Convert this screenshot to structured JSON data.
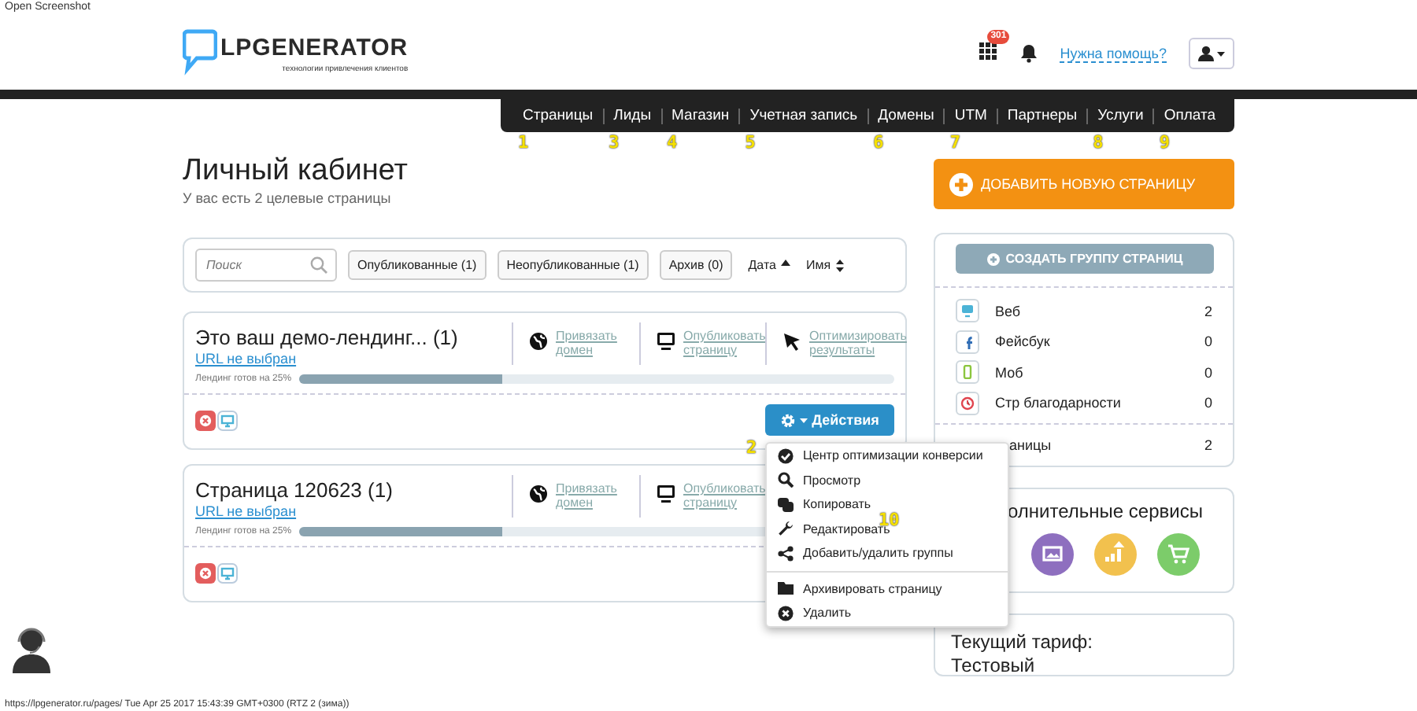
{
  "caption": "Open Screenshot",
  "header": {
    "logo_name": "LPGENERATOR",
    "logo_tagline": "технологии привлечения клиентов",
    "apps_badge": "301",
    "help_link": "Нужна помощь?"
  },
  "nav": [
    {
      "label": "Страницы",
      "annotation": "1"
    },
    {
      "label": "Лиды",
      "annotation": "3"
    },
    {
      "label": "Магазин",
      "annotation": "4"
    },
    {
      "label": "Учетная запись",
      "annotation": "5"
    },
    {
      "label": "Домены",
      "annotation": "6"
    },
    {
      "label": "UTM",
      "annotation": "7"
    },
    {
      "label": "Партнеры"
    },
    {
      "label": "Услуги",
      "annotation": "8"
    },
    {
      "label": "Оплата",
      "annotation": "9"
    }
  ],
  "page": {
    "title": "Личный кабинет",
    "subtitle": "У вас есть 2 целевые страницы"
  },
  "filters": {
    "search_placeholder": "Поиск",
    "buttons": [
      "Опубликованные (1)",
      "Неопубликованные (1)",
      "Архив (0)"
    ],
    "sorts": [
      {
        "label": "Дата",
        "kind": "asc"
      },
      {
        "label": "Имя",
        "kind": "both"
      }
    ]
  },
  "pages": [
    {
      "title": "Это ваш демо-лендинг... (1)",
      "url": "URL не выбран",
      "links": [
        {
          "kind": "globe",
          "text": "Привязать домен"
        },
        {
          "kind": "monitor",
          "text": "Опубликовать страницу"
        },
        {
          "kind": "cursor",
          "text": "Оптимизировать результаты"
        }
      ],
      "progress_label": "Лендинг готов на 25%",
      "level": 0.34,
      "actions": {
        "label": "Действия",
        "annotation": "2"
      }
    },
    {
      "title": "Страница 120623 (1)",
      "url": "URL не выбран",
      "links": [
        {
          "kind": "globe",
          "text": "Привязать домен"
        },
        {
          "kind": "monitor",
          "text": "Опубликовать страницу"
        }
      ],
      "progress_label": "Лендинг готов на 25%",
      "level": 0.34
    }
  ],
  "menu": [
    {
      "kind": "check",
      "label": "Центр оптимизации конверсии",
      "divider_before": false
    },
    {
      "kind": "search",
      "label": "Просмотр",
      "divider_before": false
    },
    {
      "kind": "copy",
      "label": "Копировать",
      "divider_before": false
    },
    {
      "kind": "wrench",
      "label": "Редактировать",
      "divider_before": false,
      "annotation": "10"
    },
    {
      "kind": "share",
      "label": "Добавить/удалить группы",
      "divider_before": false
    },
    {
      "kind": "folder",
      "label": "Архивировать страницу",
      "divider_before": true
    },
    {
      "kind": "delete",
      "label": "Удалить",
      "divider_before": false
    }
  ],
  "sidebar": {
    "add_button": "ДОБАВИТЬ НОВУЮ СТРАНИЦУ",
    "group_button": "СОЗДАТЬ ГРУППУ СТРАНИЦ",
    "groups": [
      {
        "kind": "web",
        "label": "Веб",
        "count": "2",
        "color": "#4bb3d6"
      },
      {
        "kind": "facebook",
        "label": "Фейсбук",
        "count": "0",
        "color": "#2f6db5"
      },
      {
        "kind": "mobile",
        "label": "Моб",
        "count": "0",
        "color": "#8cc63f"
      },
      {
        "kind": "thanks",
        "label": "Стр благодарности",
        "count": "0",
        "color": "#e0454f"
      }
    ],
    "total": {
      "label": "аницы",
      "count": "2"
    },
    "services_title": "олнительные сервисы",
    "services": [
      {
        "kind": "image",
        "color": "#8e6fbf"
      },
      {
        "kind": "growth",
        "color": "#f2c14e"
      },
      {
        "kind": "cart",
        "color": "#7ccc6a"
      }
    ],
    "tariff": {
      "label": "Текущий тариф:",
      "value": "Тестовый"
    }
  },
  "status_bar": "https://lpgenerator.ru/pages/ Tue Apr 25 2017 15:43:39 GMT+0300 (RTZ 2 (зима))"
}
